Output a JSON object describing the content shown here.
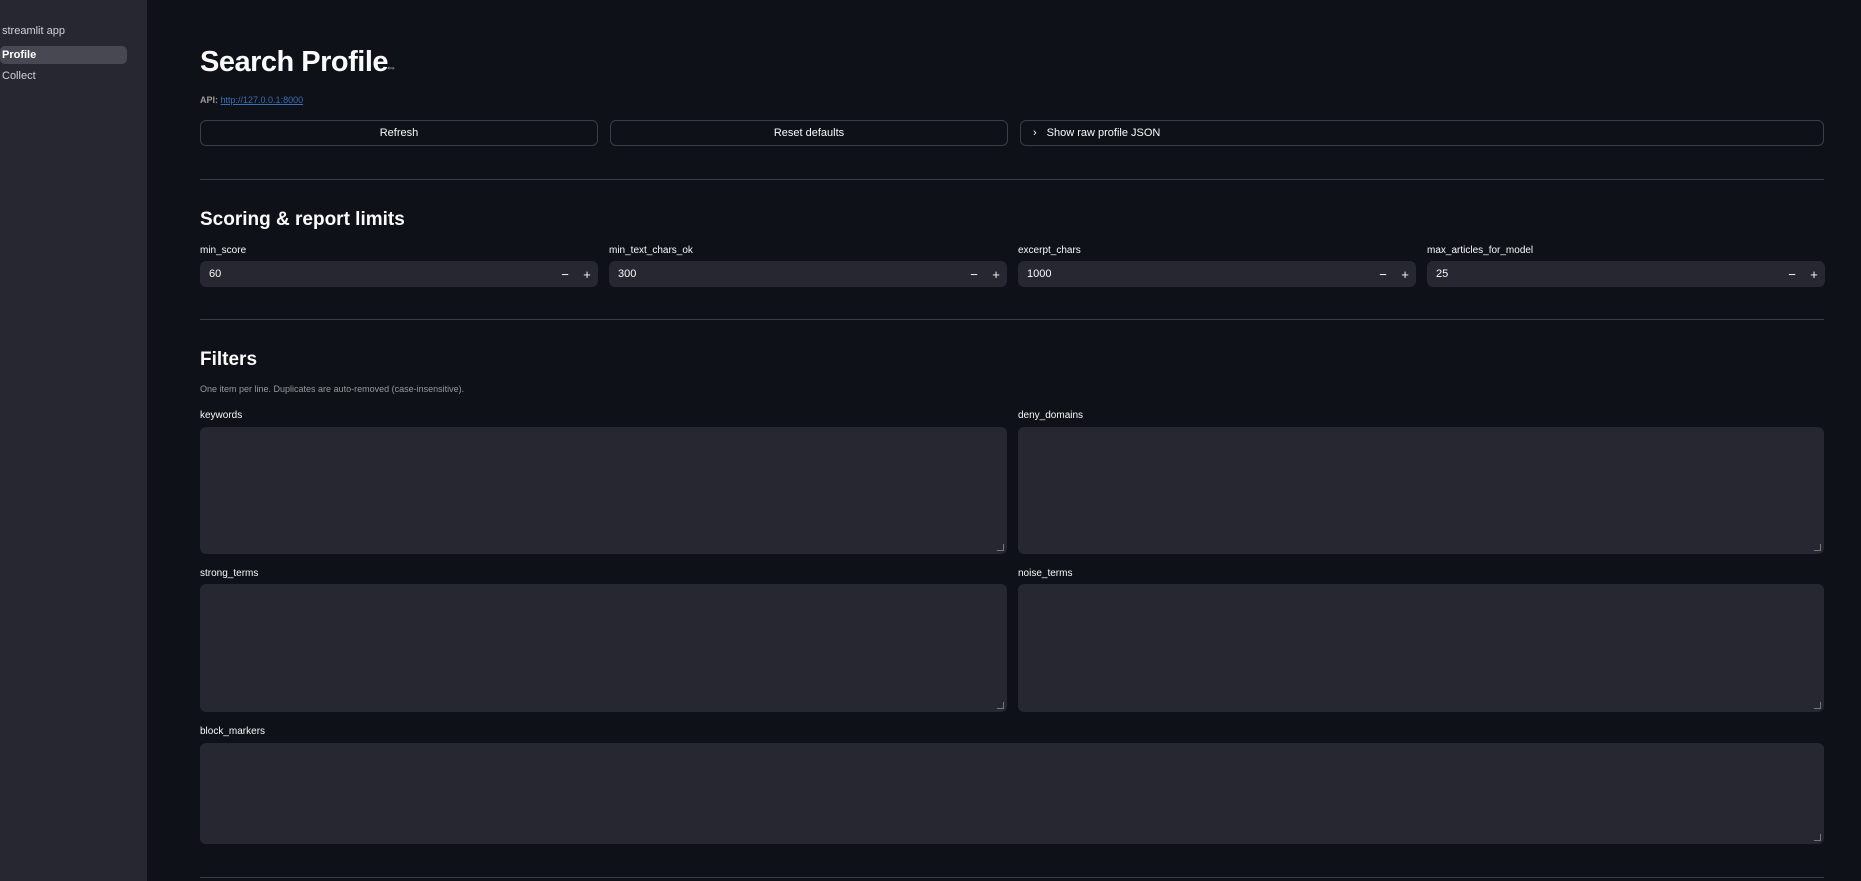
{
  "sidebar": {
    "app_title": "streamlit app",
    "items": [
      {
        "label": "Profile",
        "active": true
      },
      {
        "label": "Collect",
        "active": false
      }
    ]
  },
  "header": {
    "title": "Search Profile",
    "api_label": "API:",
    "api_url": "http://127.0.0.1:8000"
  },
  "actions": {
    "refresh": "Refresh",
    "reset": "Reset defaults",
    "show_json": "Show raw profile JSON"
  },
  "scoring": {
    "heading": "Scoring & report limits",
    "fields": [
      {
        "label": "min_score",
        "value": "60"
      },
      {
        "label": "min_text_chars_ok",
        "value": "300"
      },
      {
        "label": "excerpt_chars",
        "value": "1000"
      },
      {
        "label": "max_articles_for_model",
        "value": "25"
      }
    ],
    "minus": "−",
    "plus": "+"
  },
  "filters": {
    "heading": "Filters",
    "caption": "One item per line. Duplicates are auto-removed (case-insensitive).",
    "fields": [
      {
        "label": "keywords",
        "value": ""
      },
      {
        "label": "deny_domains",
        "value": ""
      },
      {
        "label": "strong_terms",
        "value": ""
      },
      {
        "label": "noise_terms",
        "value": ""
      },
      {
        "label": "block_markers",
        "value": ""
      }
    ]
  }
}
